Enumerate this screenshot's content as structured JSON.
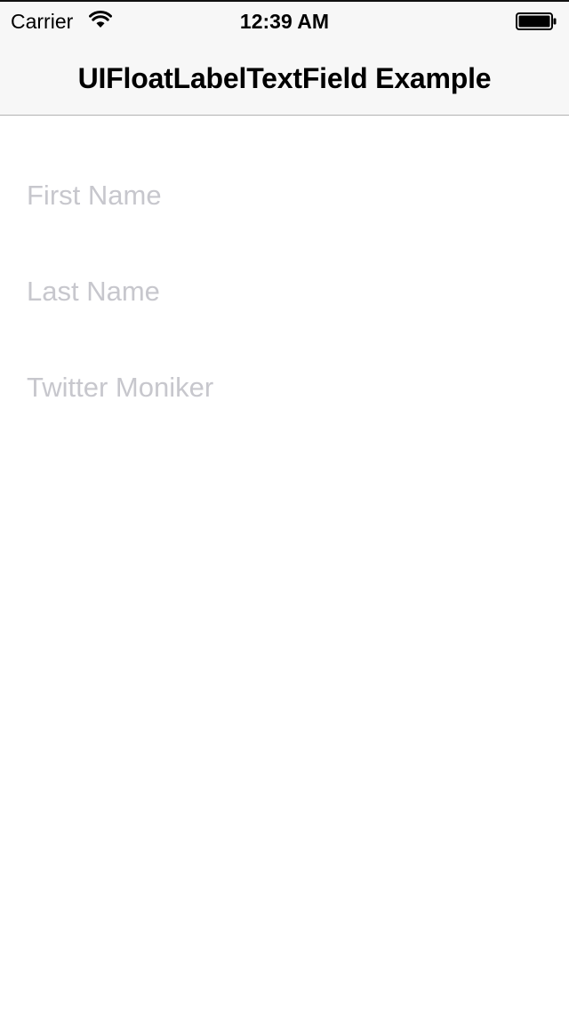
{
  "status_bar": {
    "carrier": "Carrier",
    "time": "12:39 AM",
    "wifi_icon": "wifi-icon",
    "battery_icon": "battery-icon"
  },
  "nav": {
    "title": "UIFloatLabelTextField Example"
  },
  "form": {
    "first_name": {
      "value": "",
      "placeholder": "First Name"
    },
    "last_name": {
      "value": "",
      "placeholder": "Last Name"
    },
    "twitter": {
      "value": "",
      "placeholder": "Twitter Moniker"
    }
  },
  "colors": {
    "placeholder": "#c7c7cd",
    "nav_background": "#f7f7f7",
    "nav_border": "#b2b2b2",
    "background": "#ffffff"
  }
}
